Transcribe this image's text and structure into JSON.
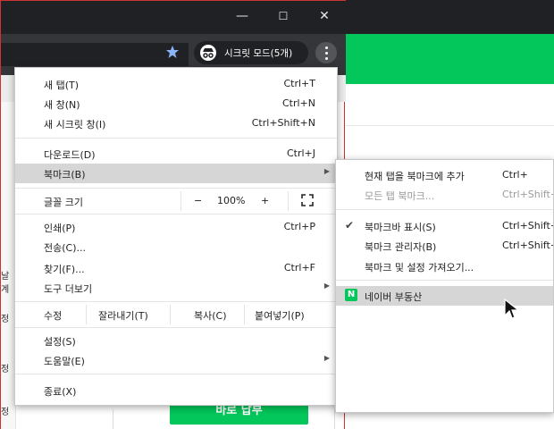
{
  "window_controls": {
    "minimize": "—",
    "maximize": "☐",
    "close": "✕"
  },
  "toolbar": {
    "incognito_label": "시크릿 모드(5개)"
  },
  "page": {
    "side_fragments": [
      "날 계",
      "정",
      "정",
      "정"
    ],
    "pay_button": "바로 납부"
  },
  "main_menu": {
    "items": [
      {
        "label": "새 탭(T)",
        "shortcut": "Ctrl+T"
      },
      {
        "label": "새 창(N)",
        "shortcut": "Ctrl+N"
      },
      {
        "label": "새 시크릿 창(I)",
        "shortcut": "Ctrl+Shift+N"
      },
      {
        "label": "다운로드(D)",
        "shortcut": "Ctrl+J"
      },
      {
        "label": "북마크(B)",
        "shortcut": ""
      },
      {
        "label": "글꼴 크기",
        "shortcut": ""
      },
      {
        "label": "인쇄(P)",
        "shortcut": "Ctrl+P"
      },
      {
        "label": "전송(C)...",
        "shortcut": ""
      },
      {
        "label": "찾기(F)...",
        "shortcut": "Ctrl+F"
      },
      {
        "label": "도구 더보기",
        "shortcut": ""
      },
      {
        "label": "수정",
        "shortcut": ""
      },
      {
        "label": "설정(S)",
        "shortcut": ""
      },
      {
        "label": "도움말(E)",
        "shortcut": ""
      },
      {
        "label": "종료(X)",
        "shortcut": ""
      }
    ],
    "zoom": {
      "minus": "−",
      "value": "100%",
      "plus": "+"
    },
    "edit": {
      "cut": "잘라내기(T)",
      "copy": "복사(C)",
      "paste": "붙여넣기(P)"
    }
  },
  "bookmark_submenu": {
    "items": [
      {
        "label": "현재 탭을 북마크에 추가",
        "shortcut": "Ctrl+"
      },
      {
        "label": "모든 탭 북마크...",
        "shortcut": "Ctrl+Shift+"
      },
      {
        "label": "북마크바 표시(S)",
        "shortcut": "Ctrl+Shift+"
      },
      {
        "label": "북마크 관리자(B)",
        "shortcut": "Ctrl+Shift+"
      },
      {
        "label": "북마크 및 설정 가져오기...",
        "shortcut": ""
      },
      {
        "label": "네이버 부동산",
        "shortcut": ""
      }
    ],
    "naver_icon_letter": "N"
  },
  "colors": {
    "accent_green": "#03c75a",
    "titlebar": "#202124",
    "highlight": "#d6d6d6"
  }
}
